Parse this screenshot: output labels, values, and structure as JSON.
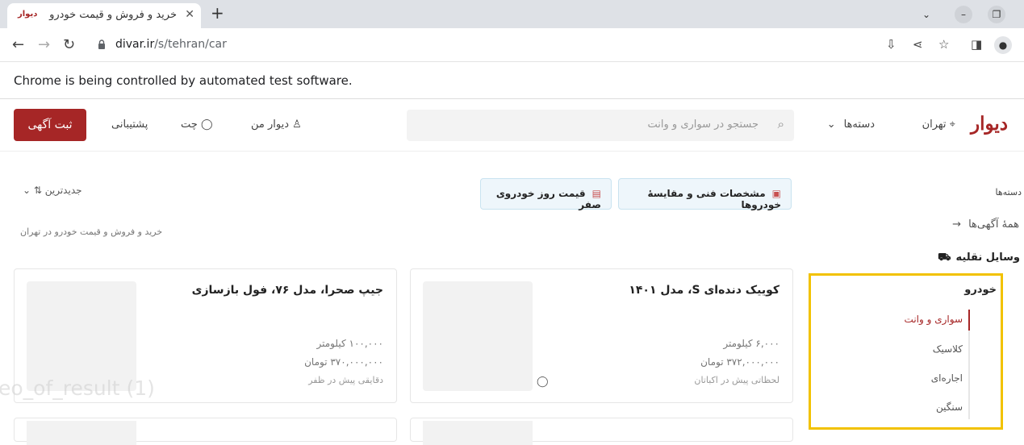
{
  "browser": {
    "tab_title": "خرید و فروش و قیمت خودرو",
    "tab_favicon": "دیوار",
    "url_domain": "divar.ir",
    "url_path": "/s/tehran/car",
    "infobar": "Chrome is being controlled by automated test software.",
    "new_tab": "+",
    "close_tab": "✕"
  },
  "header": {
    "logo": "دیوار",
    "city": "تهران",
    "categories": "دسته‌ها",
    "search_placeholder": "جستجو در سواری و وانت",
    "my_divar": "دیوار من",
    "chat": "چت",
    "support": "پشتیبانی",
    "post_ad": "ثبت آگهی"
  },
  "filters": {
    "chip_specs": "مشخصات فنی و مقایسهٔ خودروها",
    "chip_price": "قیمت روز خودروی صفر",
    "sort": "جدیدترین"
  },
  "breadcrumb": "خرید و فروش و قیمت خودرو در تهران",
  "sidebar": {
    "title": "دسته‌ها",
    "all_ads": "همهٔ آگهی‌ها",
    "vehicles": "وسایل نقلیه",
    "car": "خودرو",
    "items": [
      {
        "label": "سواری و وانت",
        "active": true
      },
      {
        "label": "کلاسیک",
        "active": false
      },
      {
        "label": "اجاره‌ای",
        "active": false
      },
      {
        "label": "سنگین",
        "active": false
      }
    ]
  },
  "listings": [
    {
      "title": "جیپ صحرا، مدل ۷۶، فول بازسازی",
      "mileage": "۱۰۰,۰۰۰ کیلومتر",
      "price": "۳۷۰,۰۰۰,۰۰۰ تومان",
      "time": "دقایقی پیش در ظفر"
    },
    {
      "title": "کوییک دنده‌ای S، مدل ۱۴۰۱",
      "mileage": "۶,۰۰۰ کیلومتر",
      "price": "۳۷۲,۰۰۰,۰۰۰ تومان",
      "time": "لحظاتی پیش در اکباتان"
    }
  ],
  "watermark": "eo_of_result (1)",
  "colors": {
    "brand": "#a62626",
    "highlight": "#f2c200",
    "chip_bg": "#eef6fb"
  }
}
